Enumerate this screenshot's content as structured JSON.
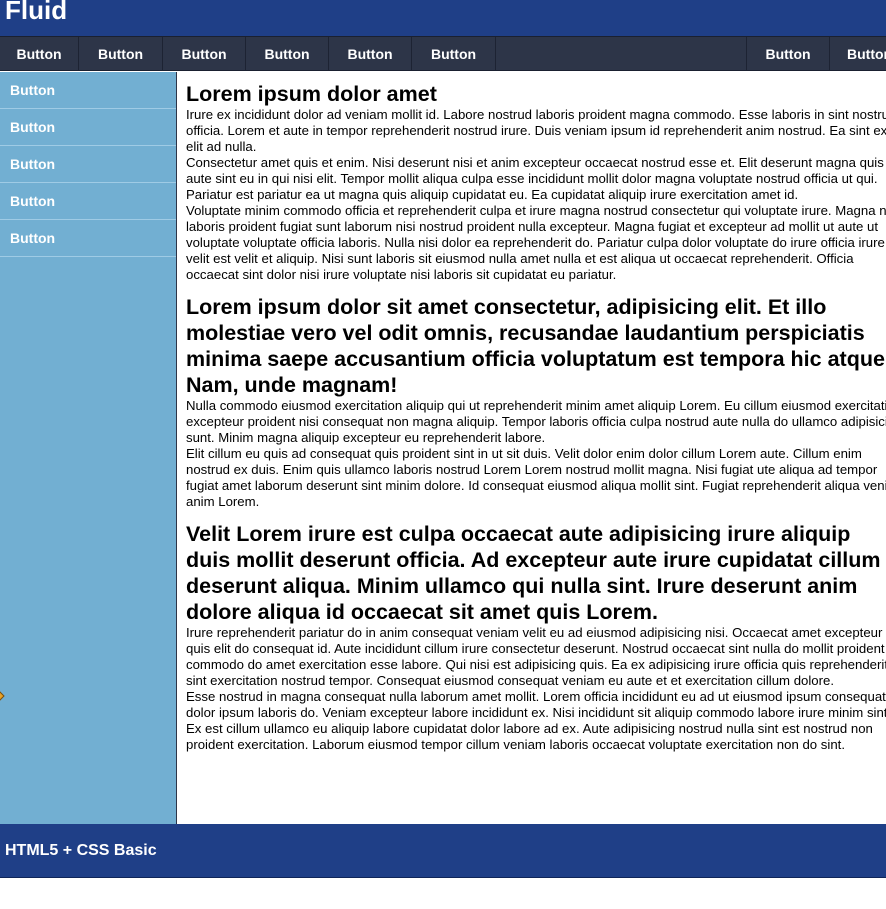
{
  "header": {
    "title": "Fluid"
  },
  "topnav": {
    "buttons": [
      "Button",
      "Button",
      "Button",
      "Button",
      "Button",
      "Button"
    ],
    "right_buttons": [
      "Button",
      "Button"
    ]
  },
  "sidebar": {
    "items": [
      "Button",
      "Button",
      "Button",
      "Button",
      "Button"
    ]
  },
  "sections": [
    {
      "heading": "Lorem ipsum dolor amet",
      "paragraphs": [
        "Irure ex incididunt dolor ad veniam mollit id. Labore nostrud laboris proident magna commodo. Esse laboris in sint nostrud officia. Lorem et aute in tempor reprehenderit nostrud irure. Duis veniam ipsum id reprehenderit anim nostrud. Ea sint ex eu elit ad nulla.",
        "Consectetur amet quis et enim. Nisi deserunt nisi et anim excepteur occaecat nostrud esse et. Elit deserunt magna quis aute sint eu in qui nisi elit. Tempor mollit aliqua culpa esse incididunt mollit dolor magna voluptate nostrud officia ut qui. Pariatur est pariatur ea ut magna quis aliquip cupidatat eu. Ea cupidatat aliquip irure exercitation amet id.",
        "Voluptate minim commodo officia et reprehenderit culpa et irure magna nostrud consectetur qui voluptate irure. Magna non laboris proident fugiat sunt laborum nisi nostrud proident nulla excepteur. Magna fugiat et excepteur ad mollit ut aute ut voluptate voluptate officia laboris. Nulla nisi dolor ea reprehenderit do. Pariatur culpa dolor voluptate do irure officia irure velit est velit et aliquip. Nisi sunt laboris sit eiusmod nulla amet nulla et est aliqua ut occaecat reprehenderit. Officia occaecat sint dolor nisi irure voluptate nisi laboris sit cupidatat eu pariatur."
      ]
    },
    {
      "heading": "Lorem ipsum dolor sit amet consectetur, adipisicing elit. Et illo molestiae vero vel odit omnis, recusandae laudantium perspiciatis minima saepe accusantium officia voluptatum est tempora hic atque. Nam, unde magnam!",
      "paragraphs": [
        "Nulla commodo eiusmod exercitation aliquip qui ut reprehenderit minim amet aliquip Lorem. Eu cillum eiusmod exercitation excepteur proident nisi consequat non magna aliquip. Tempor laboris officia culpa nostrud aute nulla do ullamco adipisicing sunt. Minim magna aliquip excepteur eu reprehenderit labore.",
        "Elit cillum eu quis ad consequat quis proident sint in ut sit duis. Velit dolor enim dolor cillum Lorem aute. Cillum enim nostrud ex duis. Enim quis ullamco laboris nostrud Lorem Lorem nostrud mollit magna. Nisi fugiat ute aliqua ad tempor fugiat amet laborum deserunt sint minim dolore. Id consequat eiusmod aliqua mollit sint. Fugiat reprehenderit aliqua veniam anim Lorem."
      ]
    },
    {
      "heading": "Velit Lorem irure est culpa occaecat aute adipisicing irure aliquip duis mollit deserunt officia. Ad excepteur aute irure cupidatat cillum deserunt aliqua. Minim ullamco qui nulla sint. Irure deserunt anim dolore aliqua id occaecat sit amet quis Lorem.",
      "paragraphs": [
        "Irure reprehenderit pariatur do in anim consequat veniam velit eu ad eiusmod adipisicing nisi. Occaecat amet excepteur quis elit do consequat id. Aute incididunt cillum irure consectetur deserunt. Nostrud occaecat sint nulla do mollit proident commodo do amet exercitation esse labore. Qui nisi est adipisicing quis. Ea ex adipisicing irure officia quis reprehenderit sint exercitation nostrud tempor. Consequat eiusmod consequat veniam eu aute et et exercitation cillum dolore.",
        "Esse nostrud in magna consequat nulla laborum amet mollit. Lorem officia incididunt eu ad ut eiusmod ipsum consequat dolor ipsum laboris do. Veniam excepteur labore incididunt ex. Nisi incididunt sit aliquip commodo labore irure minim sint. Ex est cillum ullamco eu aliquip labore cupidatat dolor labore ad ex. Aute adipisicing nostrud nulla sint est nostrud non proident exercitation. Laborum eiusmod tempor cillum veniam laboris occaecat voluptate exercitation non do sint."
      ]
    }
  ],
  "footer": {
    "text": "HTML5 + CSS Basic"
  },
  "colors": {
    "header_bg": "#1f3f87",
    "nav_bg": "#2d3548",
    "sidebar_bg": "#72afd2",
    "footer_bg": "#1f3f87"
  }
}
